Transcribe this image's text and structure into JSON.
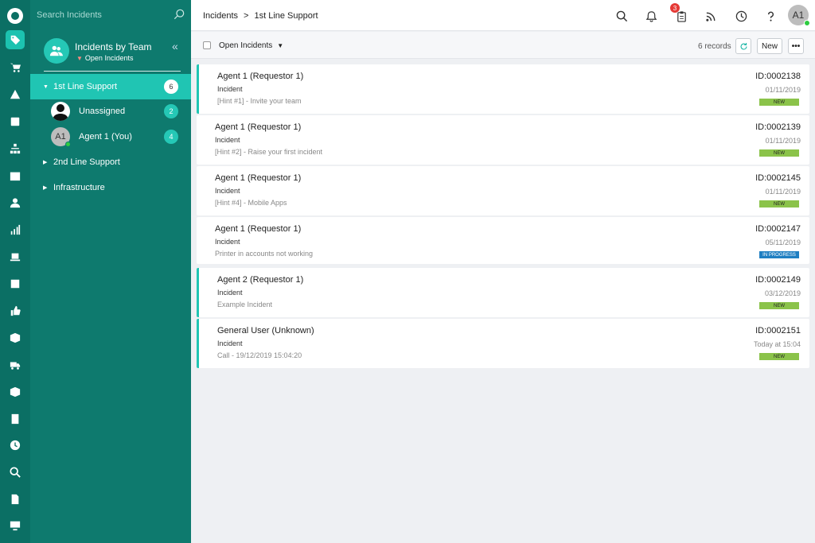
{
  "search": {
    "placeholder": "Search Incidents"
  },
  "sidebar": {
    "title": "Incidents by Team",
    "subtitle": "Open Incidents",
    "tree": [
      {
        "label": "1st Line Support",
        "count": "6",
        "expanded": true,
        "active": true
      },
      {
        "label": "2nd Line Support",
        "expanded": false
      },
      {
        "label": "Infrastructure",
        "expanded": false
      }
    ],
    "members": [
      {
        "label": "Unassigned",
        "count": "2"
      },
      {
        "label": "Agent 1 (You)",
        "count": "4",
        "initials": "A1"
      }
    ]
  },
  "rail_icons": [
    "tag-icon",
    "cart-icon",
    "warning-icon",
    "edit-icon",
    "sitemap-icon",
    "calendar-icon",
    "user-icon",
    "chart-icon",
    "laptop-icon",
    "note-icon",
    "thumbs-up-icon",
    "box-icon",
    "truck-icon",
    "cube-icon",
    "document-icon",
    "clock-icon",
    "search-icon",
    "file-icon",
    "monitor-icon"
  ],
  "header": {
    "breadcrumb": [
      "Incidents",
      "1st Line Support"
    ],
    "separator": ">",
    "notification_count": "3",
    "user_initials": "A1"
  },
  "toolbar": {
    "view_label": "Open Incidents",
    "records": "6 records",
    "new_label": "New",
    "more_label": "•••"
  },
  "colors": {
    "accent": "#20c5b3",
    "status_new": "#8bc34a",
    "status_in_progress": "#1f7fc2"
  },
  "incidents": [
    {
      "who": "Agent 1 (Requestor 1)",
      "type": "Incident",
      "desc": "[Hint #1] - Invite your team",
      "id": "ID:0002138",
      "date": "01/11/2019",
      "status": "NEW"
    },
    {
      "who": "Agent 1 (Requestor 1)",
      "type": "Incident",
      "desc": "[Hint #2] - Raise your first incident",
      "id": "ID:0002139",
      "date": "01/11/2019",
      "status": "NEW"
    },
    {
      "who": "Agent 1 (Requestor 1)",
      "type": "Incident",
      "desc": "[Hint #4] - Mobile Apps",
      "id": "ID:0002145",
      "date": "01/11/2019",
      "status": "NEW"
    },
    {
      "who": "Agent 1 (Requestor 1)",
      "type": "Incident",
      "desc": "Printer in accounts not working",
      "id": "ID:0002147",
      "date": "05/11/2019",
      "status": "IN PROGRESS"
    },
    {
      "who": "Agent 2 (Requestor 1)",
      "type": "Incident",
      "desc": "Example Incident",
      "id": "ID:0002149",
      "date": "03/12/2019",
      "status": "NEW"
    },
    {
      "who": "General User (Unknown)",
      "type": "Incident",
      "desc": "Call - 19/12/2019 15:04:20",
      "id": "ID:0002151",
      "date": "Today at 15:04",
      "status": "NEW"
    }
  ]
}
